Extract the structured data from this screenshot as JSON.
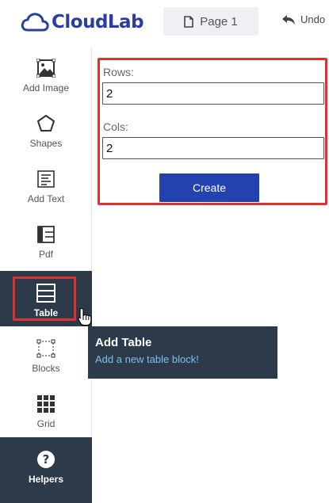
{
  "header": {
    "logo_text": "CloudLab",
    "page_tab_label": "Page 1",
    "undo_label": "Undo"
  },
  "sidebar": {
    "items": [
      {
        "label": "Add Image",
        "icon": "image-icon"
      },
      {
        "label": "Shapes",
        "icon": "pentagon-icon"
      },
      {
        "label": "Add Text",
        "icon": "text-icon"
      },
      {
        "label": "Pdf",
        "icon": "pdf-icon"
      },
      {
        "label": "Table",
        "icon": "table-icon"
      },
      {
        "label": "Blocks",
        "icon": "blocks-icon"
      },
      {
        "label": "Grid",
        "icon": "grid-icon"
      },
      {
        "label": "Helpers",
        "icon": "help-icon"
      }
    ],
    "active_item": "Table"
  },
  "form": {
    "rows_label": "Rows:",
    "rows_value": "2",
    "cols_label": "Cols:",
    "cols_value": "2",
    "create_label": "Create"
  },
  "tooltip": {
    "title": "Add Table",
    "description": "Add a new table block!"
  },
  "colors": {
    "brand": "#2a3da0",
    "button": "#2441b0",
    "dark_panel": "#2d3a4a",
    "highlight": "#e03131",
    "tooltip_link": "#7cc0ea"
  }
}
